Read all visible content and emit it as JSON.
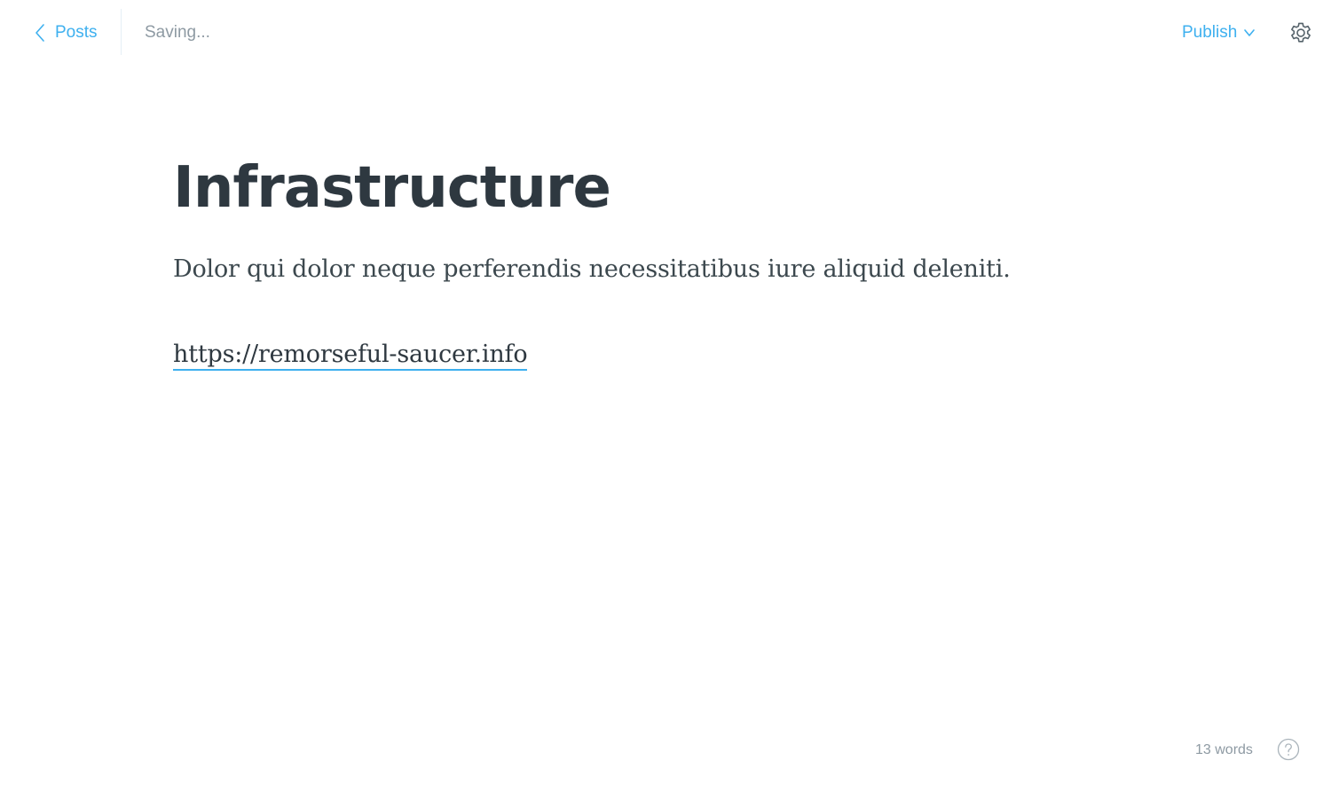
{
  "header": {
    "back_label": "Posts",
    "status": "Saving...",
    "publish_label": "Publish"
  },
  "post": {
    "title": "Infrastructure",
    "body": "Dolor qui dolor neque perferendis necessitatibus iure aliquid deleniti.",
    "link": "https://remorseful-saucer.info"
  },
  "footer": {
    "word_count": "13 words"
  },
  "icons": {
    "back": "chevron-left-icon",
    "publish": "chevron-down-icon",
    "settings": "gear-icon",
    "help": "question-circle-icon"
  },
  "colors": {
    "accent": "#3eb0ef",
    "text": "#2e3840",
    "muted": "#8e9aa3",
    "divider": "#e5eff5"
  }
}
